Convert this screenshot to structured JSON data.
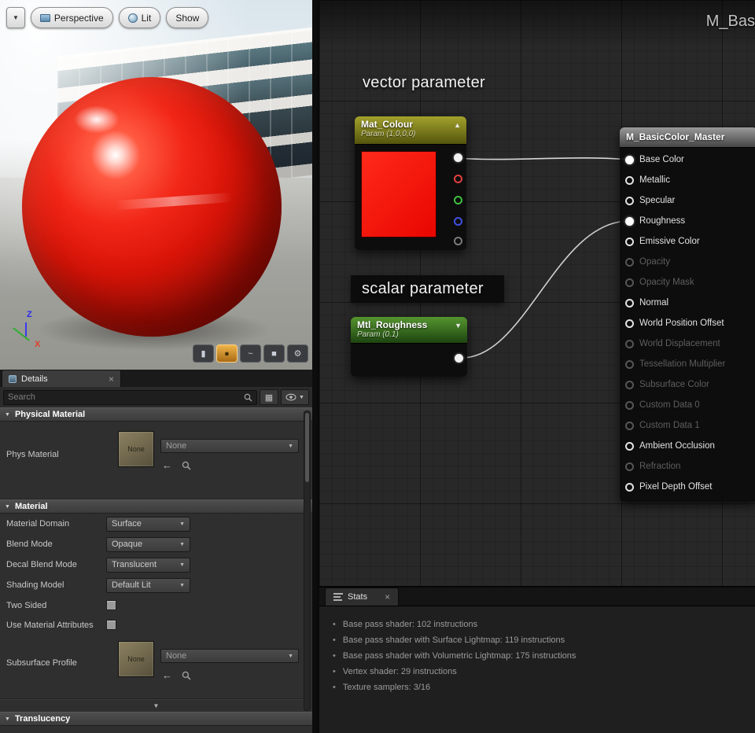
{
  "colors": {
    "preview_red": "#ee1505",
    "vector_param_header": "#8f8f20",
    "scalar_param_header": "#3f7a22",
    "master_header": "#7a7a7a",
    "selected_mesh_button": "#d08a28"
  },
  "icons": {
    "chevron_down": "▼",
    "chevron_up": "▲",
    "close": "×",
    "bullet": "•",
    "back_arrow": "←",
    "grid": "▦",
    "cylinder": "▮",
    "sphere": "●",
    "wave": "~",
    "cube": "■",
    "gear": "⚙"
  },
  "viewport": {
    "perspective_label": "Perspective",
    "lit_label": "Lit",
    "show_label": "Show",
    "axis_z": "Z",
    "axis_x": "X"
  },
  "details": {
    "tab": "Details",
    "search_placeholder": "Search",
    "physical_material": {
      "title": "Physical Material",
      "label": "Phys Material",
      "thumb_label": "None",
      "value": "None"
    },
    "material": {
      "title": "Material",
      "dropdown_rows": [
        {
          "label": "Material Domain",
          "value": "Surface"
        },
        {
          "label": "Blend Mode",
          "value": "Opaque"
        },
        {
          "label": "Decal Blend Mode",
          "value": "Translucent"
        },
        {
          "label": "Shading Model",
          "value": "Default Lit"
        }
      ],
      "checkbox_rows": [
        {
          "label": "Two Sided",
          "checked": false
        },
        {
          "label": "Use Material Attributes",
          "checked": false
        }
      ],
      "subsurface": {
        "label": "Subsurface Profile",
        "thumb_label": "None",
        "value": "None"
      }
    },
    "translucency_title": "Translucency"
  },
  "graph": {
    "title": "M_Bas",
    "vector_annotation": "vector parameter",
    "scalar_annotation": "scalar parameter",
    "mat_colour_node": {
      "title": "Mat_Colour",
      "subtitle": "Param (1,0,0,0)"
    },
    "mtl_roughness_node": {
      "title": "Mtl_Roughness",
      "subtitle": "Param (0.1)"
    },
    "master_node": {
      "title": "M_BasicColor_Master",
      "pins": [
        {
          "label": "Base Color",
          "state": "connected"
        },
        {
          "label": "Metallic",
          "state": "enabled"
        },
        {
          "label": "Specular",
          "state": "enabled"
        },
        {
          "label": "Roughness",
          "state": "connected"
        },
        {
          "label": "Emissive Color",
          "state": "enabled"
        },
        {
          "label": "Opacity",
          "state": "disabled"
        },
        {
          "label": "Opacity Mask",
          "state": "disabled"
        },
        {
          "label": "Normal",
          "state": "enabled"
        },
        {
          "label": "World Position Offset",
          "state": "enabled"
        },
        {
          "label": "World Displacement",
          "state": "disabled"
        },
        {
          "label": "Tessellation Multiplier",
          "state": "disabled"
        },
        {
          "label": "Subsurface Color",
          "state": "disabled"
        },
        {
          "label": "Custom Data 0",
          "state": "disabled"
        },
        {
          "label": "Custom Data 1",
          "state": "disabled"
        },
        {
          "label": "Ambient Occlusion",
          "state": "enabled"
        },
        {
          "label": "Refraction",
          "state": "disabled"
        },
        {
          "label": "Pixel Depth Offset",
          "state": "enabled"
        }
      ]
    }
  },
  "stats": {
    "tab": "Stats",
    "lines": [
      "Base pass shader: 102 instructions",
      "Base pass shader with Surface Lightmap: 119 instructions",
      "Base pass shader with Volumetric Lightmap: 175 instructions",
      "Vertex shader: 29 instructions",
      "Texture samplers: 3/16"
    ]
  }
}
